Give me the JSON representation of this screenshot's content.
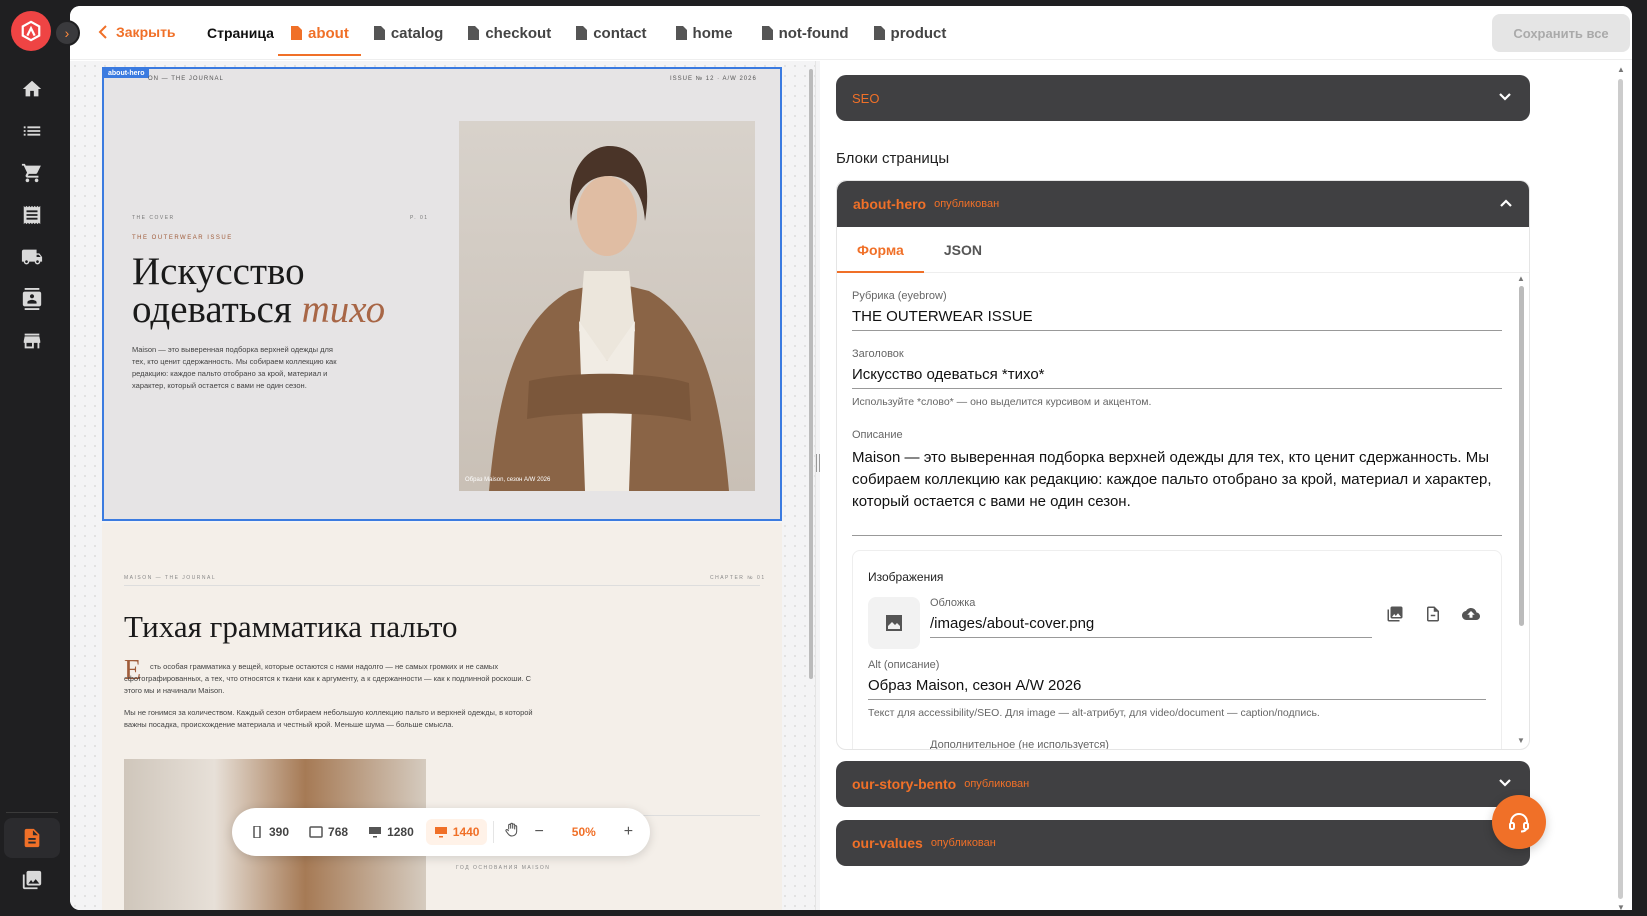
{
  "topbar": {
    "close_label": "Закрыть",
    "page_label": "Страница",
    "tabs": [
      {
        "label": "about"
      },
      {
        "label": "catalog"
      },
      {
        "label": "checkout"
      },
      {
        "label": "contact"
      },
      {
        "label": "home"
      },
      {
        "label": "not-found"
      },
      {
        "label": "product"
      }
    ],
    "save_all_label": "Сохранить все"
  },
  "sidebar": {
    "icons": [
      "home-icon",
      "list-icon",
      "cart-icon",
      "receipt-icon",
      "truck-icon",
      "contact-card-icon",
      "store-icon",
      "page-icon",
      "gallery-icon"
    ]
  },
  "preview": {
    "hero": {
      "tag": "about-hero",
      "top_left": "ON — THE JOURNAL",
      "top_right": "ISSUE № 12 · A/W 2026",
      "cover": "THE COVER",
      "page_no": "P. 01",
      "eyebrow": "THE OUTERWEAR ISSUE",
      "title_main": "Искусство одеваться",
      "title_em": "тихо",
      "description": "Maison — это выверенная подборка верхней одежды для тех, кто ценит сдержанность. Мы собираем коллекцию как редакцию: каждое пальто отобрано за крой, материал и характер, который остается с вами не один сезон.",
      "image_caption": "Образ Maison, сезон A/W 2026"
    },
    "section2": {
      "top_left": "MAISON — THE JOURNAL",
      "top_right": "CHAPTER № 01",
      "title": "Тихая грамматика пальто",
      "dropcap": "Е",
      "p1": "сть особая грамматика у вещей, которые остаются с нами надолго — не самых громких и не самых сфотографированных, а тех, что относятся к ткани как к аргументу, а к сдержанности — как к подлинной роскоши. С этого мы и начинали Maison.",
      "p2": "Мы не гонимся за количеством. Каждый сезон отбираем небольшую коллекцию пальто и верхней одежды, в которой важны посадка, происхождение материала и честный крой. Меньше шума — больше смысла.",
      "year_label": "ГОД ОСНОВАНИЯ MAISON"
    },
    "zoom": {
      "breakpoints": [
        "390",
        "768",
        "1280",
        "1440"
      ],
      "active_breakpoint": "1440",
      "zoom_level": "50%"
    }
  },
  "panel": {
    "seo_label": "SEO",
    "blocks_title": "Блоки страницы",
    "hero_block": {
      "name": "about-hero",
      "status": "опубликован",
      "tabs": [
        "Форма",
        "JSON"
      ],
      "fields": {
        "eyebrow_label": "Рубрика (eyebrow)",
        "eyebrow_value": "THE OUTERWEAR ISSUE",
        "title_label": "Заголовок",
        "title_value": "Искусство одеваться *тихо*",
        "title_hint": "Используйте *слово* — оно выделится курсивом и акцентом.",
        "desc_label": "Описание",
        "desc_value": "Maison — это выверенная подборка верхней одежды для тех, кто ценит сдержанность. Мы собираем коллекцию как редакцию: каждое пальто отобрано за крой, материал и характер, который остается с вами не один сезон."
      },
      "images": {
        "title": "Изображения",
        "cover_label": "Обложка",
        "cover_value": "/images/about-cover.png",
        "alt_label": "Alt (описание)",
        "alt_value": "Образ Maison, сезон A/W 2026",
        "alt_hint": "Текст для accessibility/SEO. Для image — alt-атрибут, для video/document — caption/подпись.",
        "extra_label": "Дополнительное (не используется)"
      }
    },
    "other_blocks": [
      {
        "name": "our-story-bento",
        "status": "опубликован"
      },
      {
        "name": "our-values",
        "status": "опубликован"
      }
    ]
  }
}
